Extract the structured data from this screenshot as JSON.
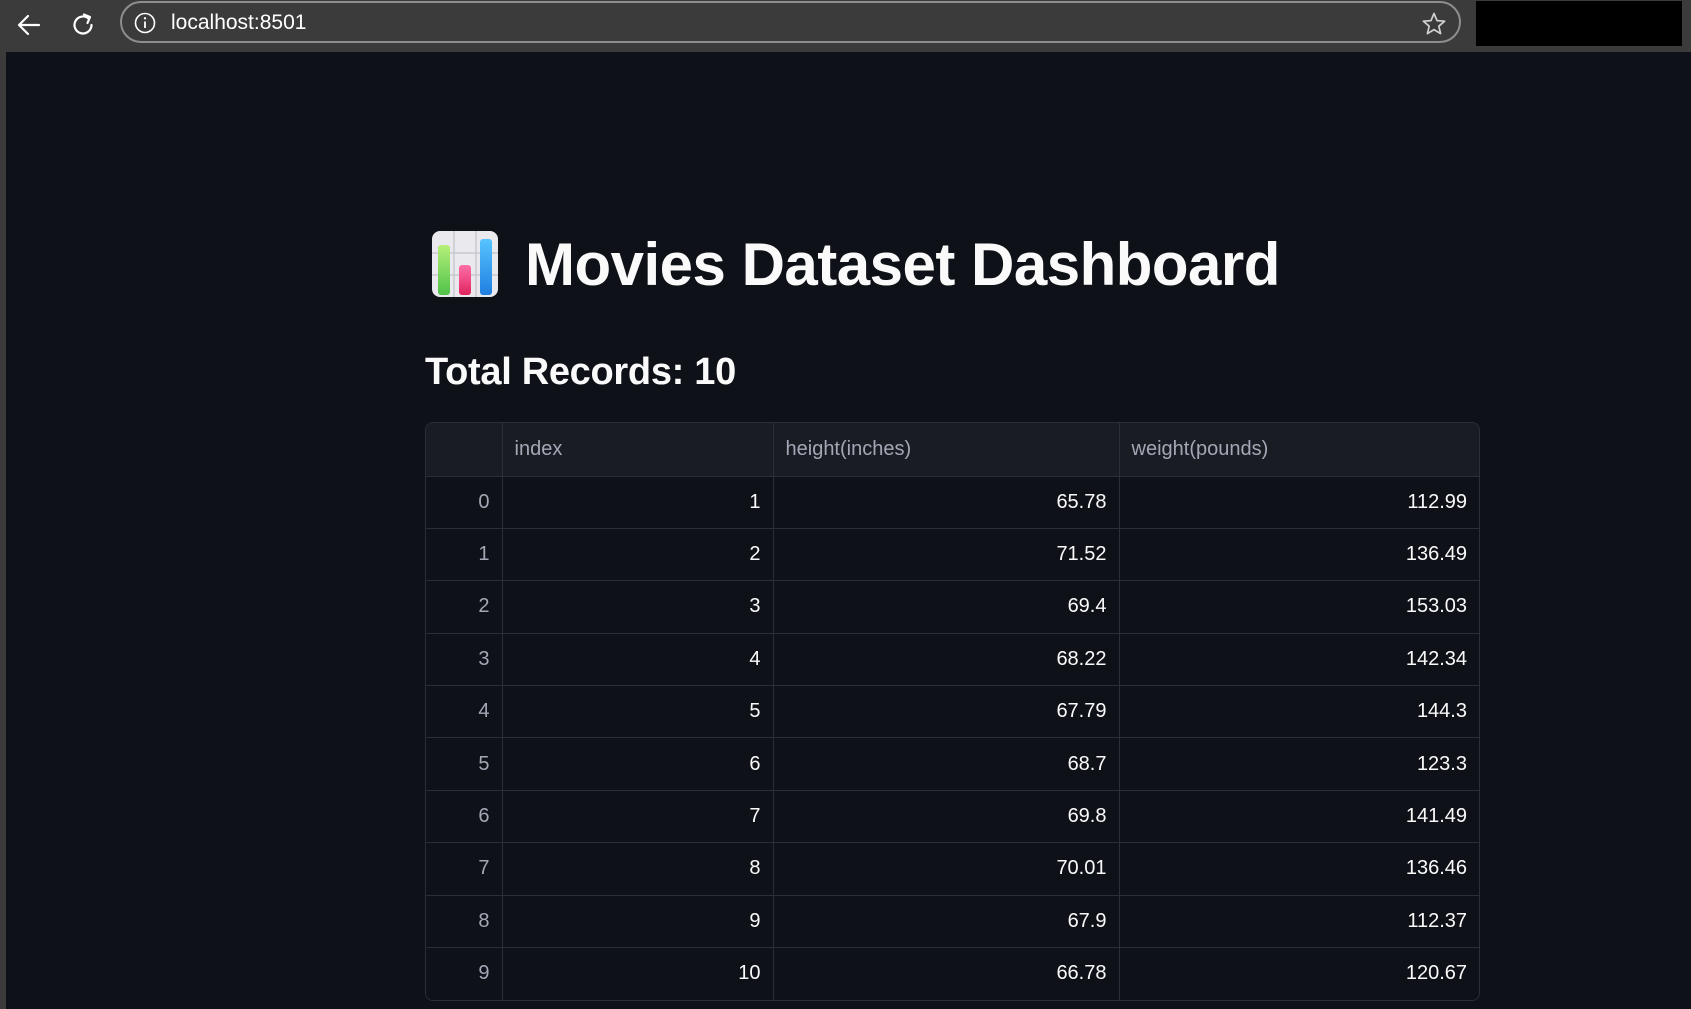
{
  "browser": {
    "url": "localhost:8501"
  },
  "page": {
    "title": "Movies Dataset Dashboard",
    "title_icon": "bar-chart-emoji",
    "subtitle": "Total Records: 10"
  },
  "table": {
    "columns": [
      "",
      "index",
      "height(inches)",
      "weight(pounds)"
    ],
    "rows": [
      {
        "row_index": "0",
        "index": "1",
        "height": "65.78",
        "weight": "112.99"
      },
      {
        "row_index": "1",
        "index": "2",
        "height": "71.52",
        "weight": "136.49"
      },
      {
        "row_index": "2",
        "index": "3",
        "height": "69.4",
        "weight": "153.03"
      },
      {
        "row_index": "3",
        "index": "4",
        "height": "68.22",
        "weight": "142.34"
      },
      {
        "row_index": "4",
        "index": "5",
        "height": "67.79",
        "weight": "144.3"
      },
      {
        "row_index": "5",
        "index": "6",
        "height": "68.7",
        "weight": "123.3"
      },
      {
        "row_index": "6",
        "index": "7",
        "height": "69.8",
        "weight": "141.49"
      },
      {
        "row_index": "7",
        "index": "8",
        "height": "70.01",
        "weight": "136.46"
      },
      {
        "row_index": "8",
        "index": "9",
        "height": "67.9",
        "weight": "112.37"
      },
      {
        "row_index": "9",
        "index": "10",
        "height": "66.78",
        "weight": "120.67"
      }
    ]
  },
  "colors": {
    "background": "#0e1117",
    "browser_chrome": "#3b3b3b",
    "text": "#fafafa",
    "muted_text": "#a3a8b4",
    "table_header": "#1a1c24",
    "grid_line": "#2a2e36"
  }
}
